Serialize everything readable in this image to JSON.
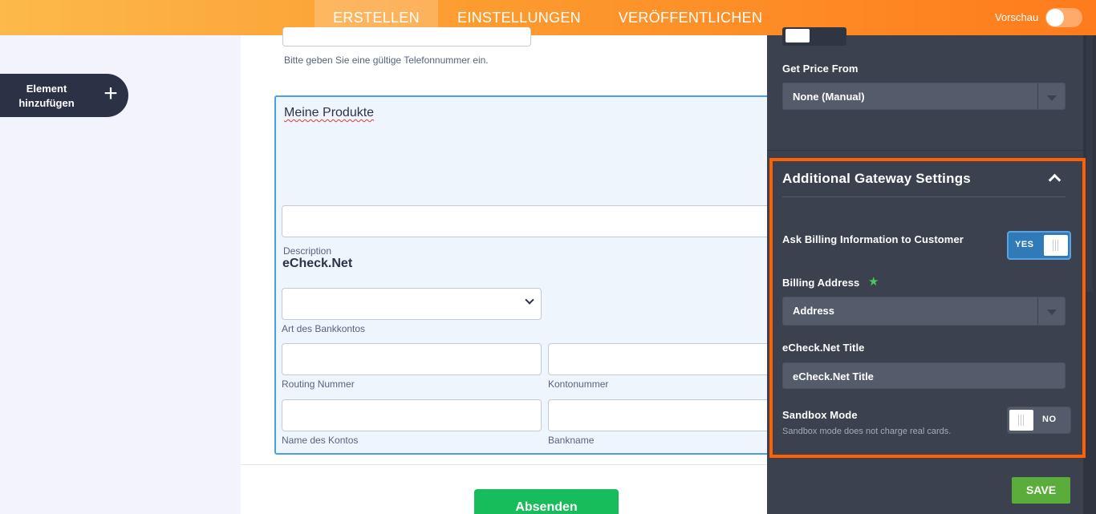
{
  "topbar": {
    "tabs": [
      {
        "label": "ERSTELLEN",
        "active": true
      },
      {
        "label": "EINSTELLUNGEN",
        "active": false
      },
      {
        "label": "VERÖFFENTLICHEN",
        "active": false
      }
    ],
    "preview_label": "Vorschau",
    "preview_enabled": false
  },
  "sidebar": {
    "add_element_line1": "Element",
    "add_element_line2": "hinzufügen"
  },
  "form": {
    "phone_hint": "Bitte geben Sie eine gültige Telefonnummer ein.",
    "product_title": "Meine Produkte",
    "description_label": "Description",
    "echeck_heading": "eCheck.Net",
    "bank_type_label": "Art des Bankkontos",
    "routing_label": "Routing Nummer",
    "account_number_label": "Kontonummer",
    "account_name_label": "Name des Kontos",
    "bank_name_label": "Bankname",
    "submit_label": "Absenden"
  },
  "panel": {
    "get_price_label": "Get Price From",
    "get_price_value": "None (Manual)",
    "gateway_title": "Additional Gateway Settings",
    "billing_info_label": "Ask Billing Information to Customer",
    "billing_info_toggle": "YES",
    "billing_address_label": "Billing Address",
    "billing_address_value": "Address",
    "echeck_title_label": "eCheck.Net Title",
    "echeck_title_value": "eCheck.Net Title",
    "sandbox_label": "Sandbox Mode",
    "sandbox_toggle": "NO",
    "sandbox_desc": "Sandbox mode does not charge real cards.",
    "save_label": "SAVE"
  },
  "colors": {
    "highlight_border": "#ff6100",
    "submit_green": "#18bd5b",
    "save_green": "#5bad3b",
    "toggle_blue": "#2f7ab7"
  }
}
